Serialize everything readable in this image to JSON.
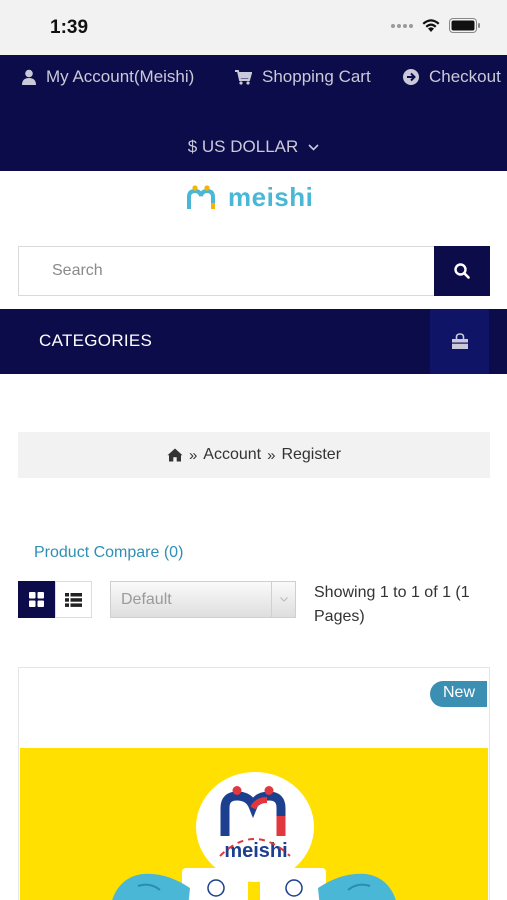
{
  "status_bar": {
    "time": "1:39"
  },
  "top_nav": {
    "account_label": "My Account(Meishi)",
    "cart_label": "Shopping Cart",
    "checkout_label": "Checkout",
    "currency_label": "$ US DOLLAR"
  },
  "logo": {
    "text": "meishi"
  },
  "search": {
    "placeholder": "Search"
  },
  "categories": {
    "label": "CATEGORIES"
  },
  "breadcrumb": {
    "items": [
      "Account",
      "Register"
    ],
    "separator": "»"
  },
  "compare": {
    "label": "Product Compare (0)"
  },
  "sort": {
    "selected": "Default"
  },
  "results": {
    "showing_text": "Showing 1 to 1 of 1 (1 Pages)"
  },
  "product": {
    "badge": "New",
    "logo_text": "meishi"
  },
  "colors": {
    "nav_bg": "#0c0c4a",
    "accent_link": "#2f8fb5",
    "badge_bg": "#3b8fb3",
    "product_bg": "#ffe000"
  },
  "icons": {
    "account": "user-icon",
    "cart": "shopping-cart-icon",
    "checkout": "arrow-circle-right-icon",
    "search": "search-icon",
    "bag": "shopping-bag-icon",
    "home": "home-icon",
    "grid": "grid-view-icon",
    "list": "list-view-icon"
  }
}
